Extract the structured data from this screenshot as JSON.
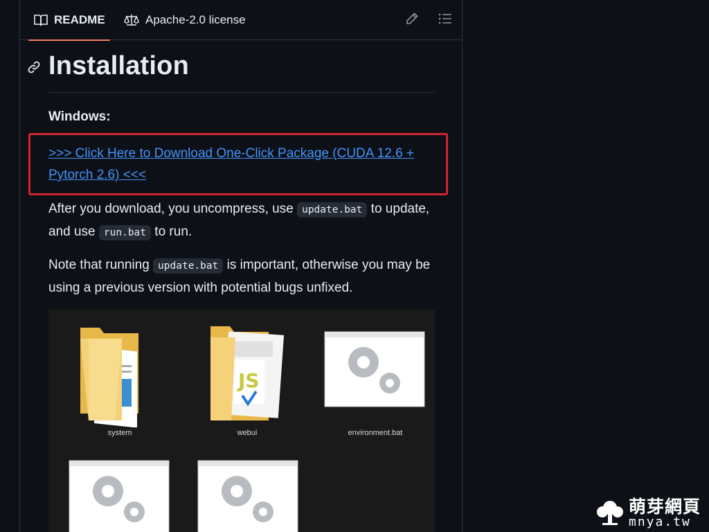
{
  "tabs": {
    "readme_label": "README",
    "license_label": "Apache-2.0 license"
  },
  "actions": {
    "edit_icon": "pencil-icon",
    "outline_icon": "list-unordered-icon"
  },
  "section": {
    "title": "Installation",
    "windows_label": "Windows:",
    "download_link": ">>> Click Here to Download One-Click Package (CUDA 12.6 + Pytorch 2.6) <<<",
    "para1": {
      "t1": "After you download, you uncompress, use ",
      "code1": "update.bat",
      "t2": " to update, and use ",
      "code2": "run.bat",
      "t3": " to run."
    },
    "para2": {
      "t1": "Note that running ",
      "code1": "update.bat",
      "t2": " is important, otherwise you may be using a previous version with potential bugs unfixed."
    }
  },
  "files": [
    {
      "label": "system",
      "icon": "folder-icon"
    },
    {
      "label": "webui",
      "icon": "folder-icon"
    },
    {
      "label": "environment.bat",
      "icon": "batch-file-icon"
    },
    {
      "label": "",
      "icon": "batch-file-icon"
    },
    {
      "label": "",
      "icon": "batch-file-icon"
    }
  ],
  "watermark": {
    "zh": "萌芽網頁",
    "en": "mnya.tw"
  },
  "colors": {
    "accent_tab": "#f78166",
    "link": "#4493f8",
    "highlight": "#d1242f",
    "background": "#0d1117"
  }
}
